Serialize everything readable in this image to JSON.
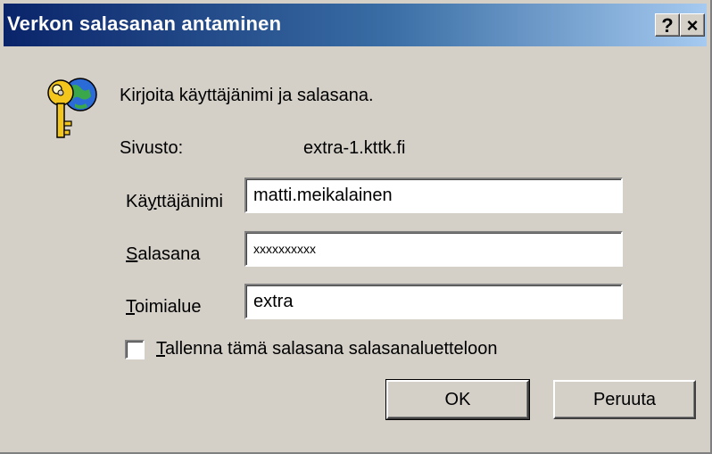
{
  "window": {
    "title": "Verkon salasanan antaminen",
    "help_label": "?",
    "close_label": "×"
  },
  "dialog": {
    "prompt": "Kirjoita käyttäjänimi ja salasana.",
    "site_label": "Sivusto:",
    "site_value": "extra-1.kttk.fi",
    "icon": "key-and-globe-icon"
  },
  "fields": {
    "username": {
      "label_accel": "K",
      "label_accel_char": "y",
      "label_pre": "Kä",
      "label_post": "ttäjänimi",
      "value": "matti.meikalainen"
    },
    "password": {
      "label_accel": "S",
      "label_rest": "alasana",
      "value": "xxxxxxxxxx"
    },
    "domain": {
      "label_accel": "T",
      "label_rest": "oimialue",
      "value": "extra"
    }
  },
  "save_password": {
    "label_accel": "T",
    "label_rest": "allenna tämä salasana salasanaluetteloon",
    "checked": false
  },
  "buttons": {
    "ok": "OK",
    "cancel": "Peruuta"
  },
  "colors": {
    "title_start": "#0a246a",
    "title_end": "#a6caf0",
    "face": "#d4d0c8"
  }
}
